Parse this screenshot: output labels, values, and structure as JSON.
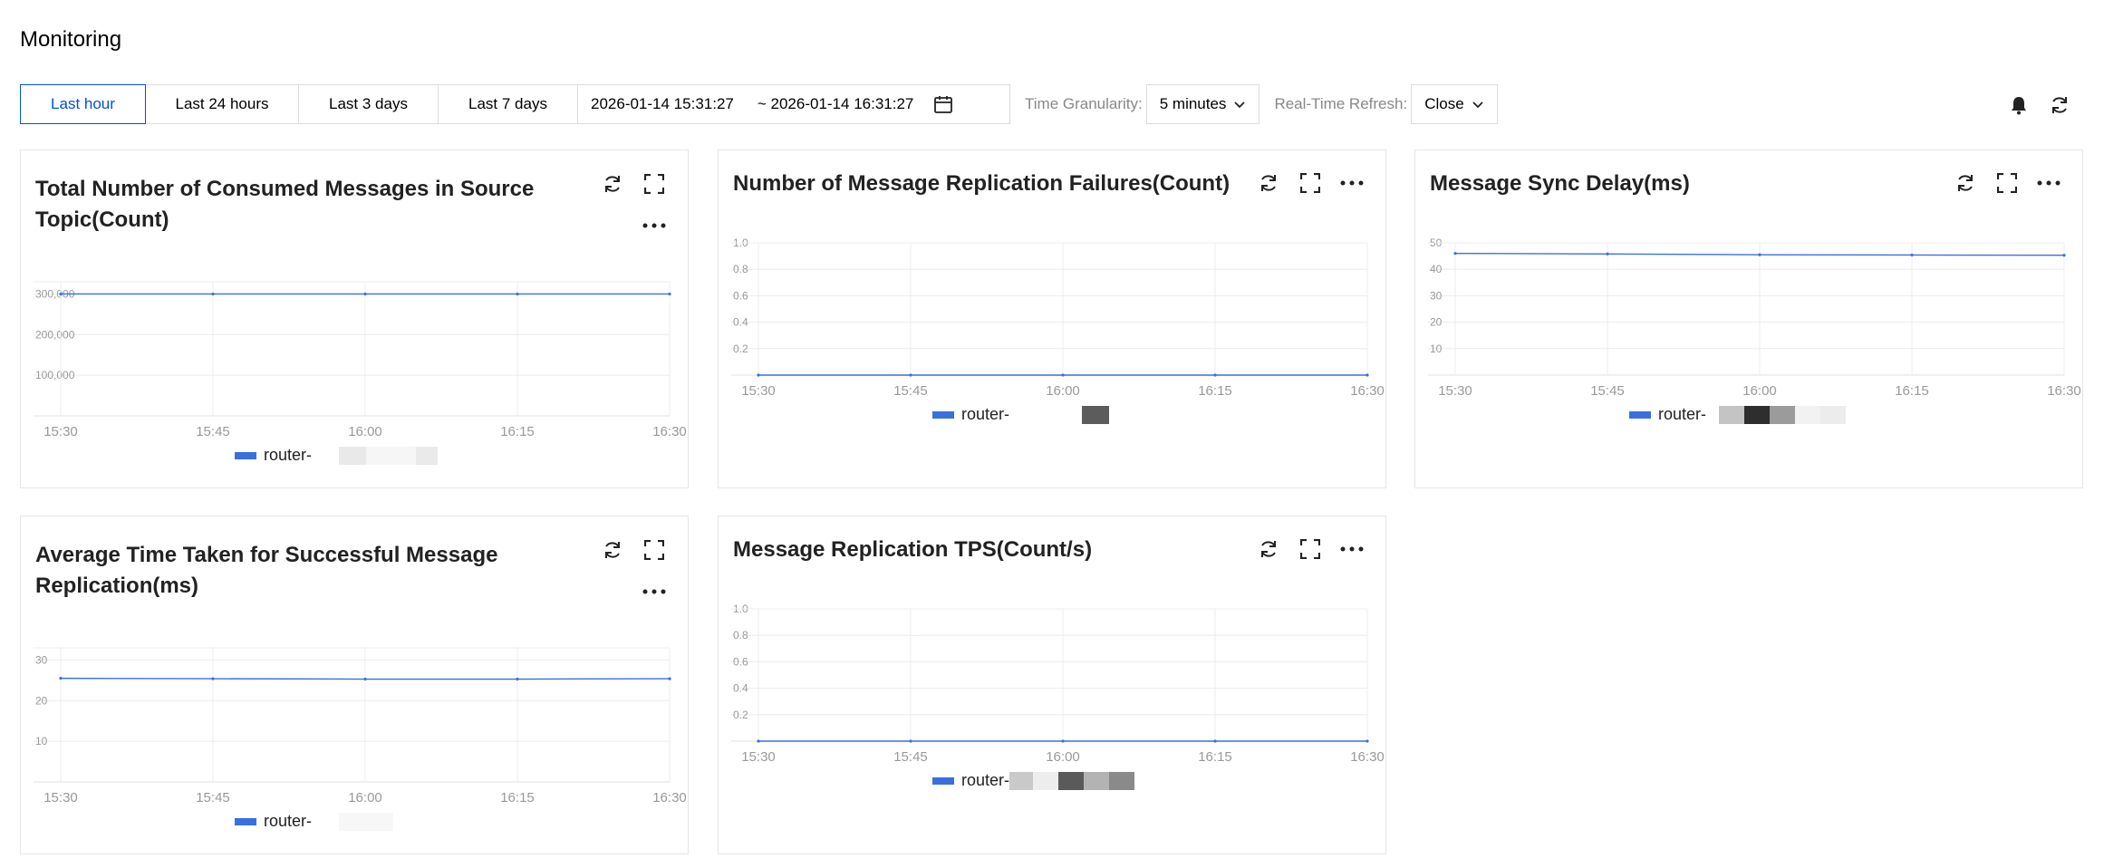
{
  "page": {
    "title": "Monitoring"
  },
  "toolbar": {
    "ranges": [
      "Last hour",
      "Last 24 hours",
      "Last 3 days",
      "Last 7 days"
    ],
    "active_range": "Last hour",
    "date_start": "2026-01-14 15:31:27",
    "date_end": "~ 2026-01-14 16:31:27",
    "granularity_label": "Time Granularity:",
    "granularity_value": "5 minutes",
    "refresh_label": "Real-Time Refresh:",
    "refresh_value": "Close"
  },
  "colors": {
    "series": "#3a6fe0",
    "active": "#0052d9",
    "grid": "#ececec"
  },
  "cards": [
    {
      "title_line1": "Total Number of Consumed Messages in Source",
      "title_line2": "Topic(Count)",
      "legend": "router-"
    },
    {
      "title_line1": "Number of Message Replication Failures(Count)",
      "legend": "router-"
    },
    {
      "title_line1": "Message Sync Delay(ms)",
      "legend": "router-"
    },
    {
      "title_line1": "Average Time Taken for Successful Message",
      "title_line2": "Replication(ms)",
      "legend": "router-"
    },
    {
      "title_line1": "Message Replication TPS(Count/s)",
      "legend": "router-"
    }
  ],
  "chart_data": [
    {
      "type": "line",
      "x": [
        "15:30",
        "15:45",
        "16:00",
        "16:15",
        "16:30"
      ],
      "yticks": [
        "100,000",
        "200,000",
        "300,000"
      ],
      "ylim": [
        0,
        330000
      ],
      "series": [
        {
          "name": "router-",
          "values": [
            300000,
            300000,
            300000,
            300000,
            300000
          ]
        }
      ]
    },
    {
      "type": "line",
      "x": [
        "15:30",
        "15:45",
        "16:00",
        "16:15",
        "16:30"
      ],
      "yticks": [
        "0.2",
        "0.4",
        "0.6",
        "0.8",
        "1.0"
      ],
      "ylim": [
        0,
        1.0
      ],
      "series": [
        {
          "name": "router-",
          "values": [
            0,
            0,
            0,
            0,
            0
          ]
        }
      ]
    },
    {
      "type": "line",
      "x": [
        "15:30",
        "15:45",
        "16:00",
        "16:15",
        "16:30"
      ],
      "yticks": [
        "10",
        "20",
        "30",
        "40",
        "50"
      ],
      "ylim": [
        0,
        50
      ],
      "series": [
        {
          "name": "router-",
          "values": [
            46,
            45.8,
            45.5,
            45.4,
            45.3
          ]
        }
      ]
    },
    {
      "type": "line",
      "x": [
        "15:30",
        "15:45",
        "16:00",
        "16:15",
        "16:30"
      ],
      "yticks": [
        "10",
        "20",
        "30"
      ],
      "ylim": [
        0,
        33
      ],
      "series": [
        {
          "name": "router-",
          "values": [
            25.5,
            25.4,
            25.3,
            25.3,
            25.4
          ]
        }
      ]
    },
    {
      "type": "line",
      "x": [
        "15:30",
        "15:45",
        "16:00",
        "16:15",
        "16:30"
      ],
      "yticks": [
        "0.2",
        "0.4",
        "0.6",
        "0.8",
        "1.0"
      ],
      "ylim": [
        0,
        1.0
      ],
      "series": [
        {
          "name": "router-",
          "values": [
            0,
            0,
            0,
            0,
            0
          ]
        }
      ]
    }
  ]
}
